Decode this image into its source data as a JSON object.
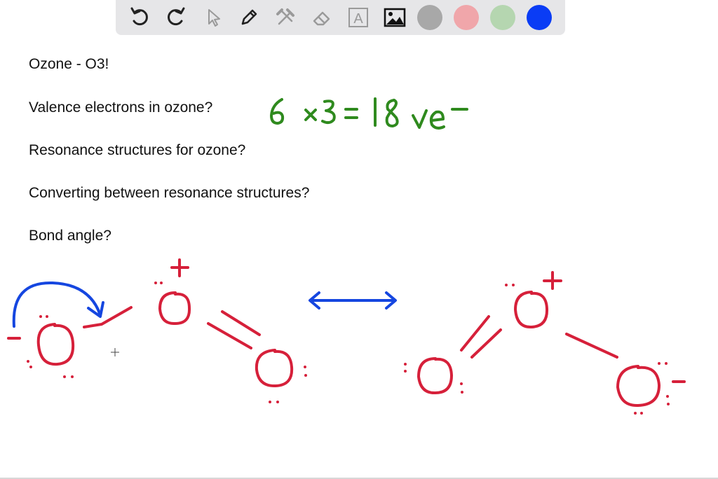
{
  "toolbar": {
    "tools": [
      {
        "name": "undo-icon"
      },
      {
        "name": "redo-icon"
      },
      {
        "name": "pointer-icon"
      },
      {
        "name": "pen-icon"
      },
      {
        "name": "tools-icon"
      },
      {
        "name": "eraser-icon"
      },
      {
        "name": "text-icon",
        "glyph": "A"
      },
      {
        "name": "image-icon"
      }
    ],
    "colors": [
      {
        "name": "color-gray",
        "hex": "#a8a8a8"
      },
      {
        "name": "color-pink",
        "hex": "#f0a6aa"
      },
      {
        "name": "color-light-green",
        "hex": "#b5d6b0"
      },
      {
        "name": "color-blue",
        "hex": "#0a3cf5"
      }
    ]
  },
  "notes": {
    "line1": "Ozone - O3!",
    "line2": "Valence electrons in ozone?",
    "line3": "Resonance structures for ozone?",
    "line4": "Converting between resonance structures?",
    "line5": "Bond angle?"
  },
  "handwriting": {
    "equation": "6 × 3 = 18 ve −",
    "plus_sign": "+",
    "minus_sign": "−",
    "atom_label": "O"
  },
  "ink_colors": {
    "red": "#d6203a",
    "blue": "#1546e0",
    "green": "#2f8a1e"
  }
}
